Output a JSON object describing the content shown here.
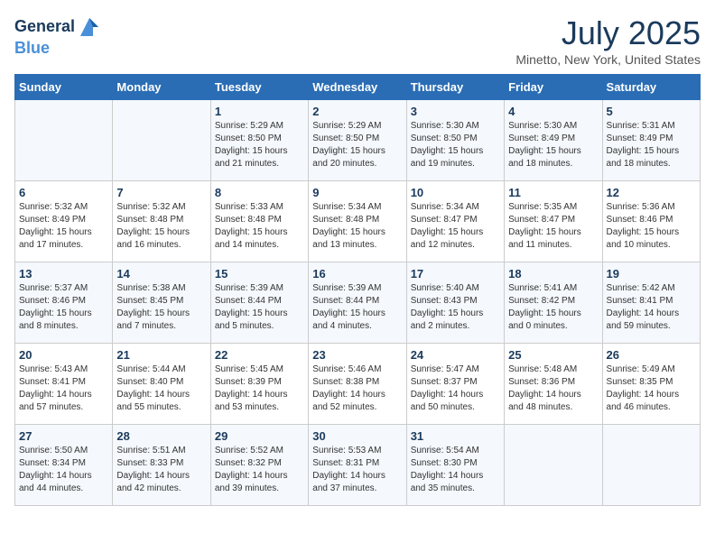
{
  "logo": {
    "line1": "General",
    "line2": "Blue"
  },
  "title": "July 2025",
  "location": "Minetto, New York, United States",
  "weekdays": [
    "Sunday",
    "Monday",
    "Tuesday",
    "Wednesday",
    "Thursday",
    "Friday",
    "Saturday"
  ],
  "weeks": [
    [
      {
        "day": "",
        "sunrise": "",
        "sunset": "",
        "daylight": ""
      },
      {
        "day": "",
        "sunrise": "",
        "sunset": "",
        "daylight": ""
      },
      {
        "day": "1",
        "sunrise": "Sunrise: 5:29 AM",
        "sunset": "Sunset: 8:50 PM",
        "daylight": "Daylight: 15 hours and 21 minutes."
      },
      {
        "day": "2",
        "sunrise": "Sunrise: 5:29 AM",
        "sunset": "Sunset: 8:50 PM",
        "daylight": "Daylight: 15 hours and 20 minutes."
      },
      {
        "day": "3",
        "sunrise": "Sunrise: 5:30 AM",
        "sunset": "Sunset: 8:50 PM",
        "daylight": "Daylight: 15 hours and 19 minutes."
      },
      {
        "day": "4",
        "sunrise": "Sunrise: 5:30 AM",
        "sunset": "Sunset: 8:49 PM",
        "daylight": "Daylight: 15 hours and 18 minutes."
      },
      {
        "day": "5",
        "sunrise": "Sunrise: 5:31 AM",
        "sunset": "Sunset: 8:49 PM",
        "daylight": "Daylight: 15 hours and 18 minutes."
      }
    ],
    [
      {
        "day": "6",
        "sunrise": "Sunrise: 5:32 AM",
        "sunset": "Sunset: 8:49 PM",
        "daylight": "Daylight: 15 hours and 17 minutes."
      },
      {
        "day": "7",
        "sunrise": "Sunrise: 5:32 AM",
        "sunset": "Sunset: 8:48 PM",
        "daylight": "Daylight: 15 hours and 16 minutes."
      },
      {
        "day": "8",
        "sunrise": "Sunrise: 5:33 AM",
        "sunset": "Sunset: 8:48 PM",
        "daylight": "Daylight: 15 hours and 14 minutes."
      },
      {
        "day": "9",
        "sunrise": "Sunrise: 5:34 AM",
        "sunset": "Sunset: 8:48 PM",
        "daylight": "Daylight: 15 hours and 13 minutes."
      },
      {
        "day": "10",
        "sunrise": "Sunrise: 5:34 AM",
        "sunset": "Sunset: 8:47 PM",
        "daylight": "Daylight: 15 hours and 12 minutes."
      },
      {
        "day": "11",
        "sunrise": "Sunrise: 5:35 AM",
        "sunset": "Sunset: 8:47 PM",
        "daylight": "Daylight: 15 hours and 11 minutes."
      },
      {
        "day": "12",
        "sunrise": "Sunrise: 5:36 AM",
        "sunset": "Sunset: 8:46 PM",
        "daylight": "Daylight: 15 hours and 10 minutes."
      }
    ],
    [
      {
        "day": "13",
        "sunrise": "Sunrise: 5:37 AM",
        "sunset": "Sunset: 8:46 PM",
        "daylight": "Daylight: 15 hours and 8 minutes."
      },
      {
        "day": "14",
        "sunrise": "Sunrise: 5:38 AM",
        "sunset": "Sunset: 8:45 PM",
        "daylight": "Daylight: 15 hours and 7 minutes."
      },
      {
        "day": "15",
        "sunrise": "Sunrise: 5:39 AM",
        "sunset": "Sunset: 8:44 PM",
        "daylight": "Daylight: 15 hours and 5 minutes."
      },
      {
        "day": "16",
        "sunrise": "Sunrise: 5:39 AM",
        "sunset": "Sunset: 8:44 PM",
        "daylight": "Daylight: 15 hours and 4 minutes."
      },
      {
        "day": "17",
        "sunrise": "Sunrise: 5:40 AM",
        "sunset": "Sunset: 8:43 PM",
        "daylight": "Daylight: 15 hours and 2 minutes."
      },
      {
        "day": "18",
        "sunrise": "Sunrise: 5:41 AM",
        "sunset": "Sunset: 8:42 PM",
        "daylight": "Daylight: 15 hours and 0 minutes."
      },
      {
        "day": "19",
        "sunrise": "Sunrise: 5:42 AM",
        "sunset": "Sunset: 8:41 PM",
        "daylight": "Daylight: 14 hours and 59 minutes."
      }
    ],
    [
      {
        "day": "20",
        "sunrise": "Sunrise: 5:43 AM",
        "sunset": "Sunset: 8:41 PM",
        "daylight": "Daylight: 14 hours and 57 minutes."
      },
      {
        "day": "21",
        "sunrise": "Sunrise: 5:44 AM",
        "sunset": "Sunset: 8:40 PM",
        "daylight": "Daylight: 14 hours and 55 minutes."
      },
      {
        "day": "22",
        "sunrise": "Sunrise: 5:45 AM",
        "sunset": "Sunset: 8:39 PM",
        "daylight": "Daylight: 14 hours and 53 minutes."
      },
      {
        "day": "23",
        "sunrise": "Sunrise: 5:46 AM",
        "sunset": "Sunset: 8:38 PM",
        "daylight": "Daylight: 14 hours and 52 minutes."
      },
      {
        "day": "24",
        "sunrise": "Sunrise: 5:47 AM",
        "sunset": "Sunset: 8:37 PM",
        "daylight": "Daylight: 14 hours and 50 minutes."
      },
      {
        "day": "25",
        "sunrise": "Sunrise: 5:48 AM",
        "sunset": "Sunset: 8:36 PM",
        "daylight": "Daylight: 14 hours and 48 minutes."
      },
      {
        "day": "26",
        "sunrise": "Sunrise: 5:49 AM",
        "sunset": "Sunset: 8:35 PM",
        "daylight": "Daylight: 14 hours and 46 minutes."
      }
    ],
    [
      {
        "day": "27",
        "sunrise": "Sunrise: 5:50 AM",
        "sunset": "Sunset: 8:34 PM",
        "daylight": "Daylight: 14 hours and 44 minutes."
      },
      {
        "day": "28",
        "sunrise": "Sunrise: 5:51 AM",
        "sunset": "Sunset: 8:33 PM",
        "daylight": "Daylight: 14 hours and 42 minutes."
      },
      {
        "day": "29",
        "sunrise": "Sunrise: 5:52 AM",
        "sunset": "Sunset: 8:32 PM",
        "daylight": "Daylight: 14 hours and 39 minutes."
      },
      {
        "day": "30",
        "sunrise": "Sunrise: 5:53 AM",
        "sunset": "Sunset: 8:31 PM",
        "daylight": "Daylight: 14 hours and 37 minutes."
      },
      {
        "day": "31",
        "sunrise": "Sunrise: 5:54 AM",
        "sunset": "Sunset: 8:30 PM",
        "daylight": "Daylight: 14 hours and 35 minutes."
      },
      {
        "day": "",
        "sunrise": "",
        "sunset": "",
        "daylight": ""
      },
      {
        "day": "",
        "sunrise": "",
        "sunset": "",
        "daylight": ""
      }
    ]
  ]
}
